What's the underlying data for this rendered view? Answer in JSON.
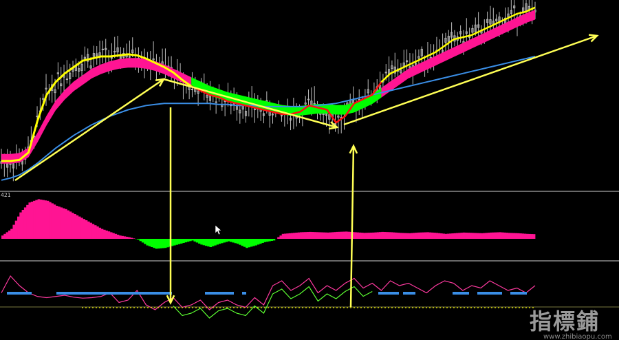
{
  "chart_data": {
    "type": "line",
    "title": "",
    "panes": [
      {
        "name": "price",
        "grid": false
      },
      {
        "name": "histogram",
        "grid": false,
        "label": "421"
      },
      {
        "name": "oscillator",
        "grid": false
      }
    ],
    "colors": {
      "background": "#000000",
      "separator": "#8a8a8a",
      "candles": "#bdbdbd",
      "fast_ma_up": "#ffff00",
      "fast_ma_down": "#ff1010",
      "band_bull": "#ff1493",
      "band_bear": "#00ff00",
      "slow_ma": "#3a8ee6",
      "annotation": "#ffff55",
      "hist_pos": "#ff1493",
      "hist_neg": "#00ff00",
      "osc_pos": "#ff3aa0",
      "osc_neg": "#5cff32",
      "osc_dash": "#3a8ee6",
      "osc_dots": "#ffff00",
      "cursor": "#ffffff"
    },
    "bars": 180,
    "series": [
      {
        "values": [
          22,
          22,
          23,
          30,
          60,
          84,
          96,
          104,
          110,
          116,
          118,
          120,
          120,
          121,
          122,
          121,
          118,
          114,
          110,
          105,
          98,
          92,
          88,
          84,
          82,
          78,
          76,
          74,
          72,
          70,
          68,
          66,
          66,
          68,
          74,
          72,
          70,
          58,
          64,
          76,
          80,
          84,
          96,
          104,
          108,
          112,
          116,
          120,
          124,
          130,
          136,
          138,
          140,
          144,
          148,
          152,
          156,
          160,
          162,
          166
        ]
      },
      {
        "values": [
          24,
          24,
          25,
          30,
          44,
          60,
          74,
          84,
          92,
          98,
          104,
          108,
          111,
          113,
          114,
          114,
          113,
          111,
          108,
          104,
          100,
          96,
          92,
          88,
          85,
          82,
          80,
          78,
          76,
          74,
          72,
          70,
          69,
          69,
          70,
          71,
          71,
          70,
          70,
          72,
          76,
          80,
          86,
          92,
          98,
          104,
          108,
          112,
          116,
          120,
          124,
          128,
          132,
          136,
          140,
          144,
          148,
          152,
          156,
          159
        ]
      },
      {
        "values": [
          4,
          6,
          9,
          14,
          20,
          27,
          34,
          40,
          46,
          51,
          56,
          60,
          64,
          67,
          70,
          72,
          74,
          75,
          76,
          76,
          76,
          76,
          76,
          76,
          75,
          75,
          74,
          74,
          74,
          73,
          73,
          73,
          73,
          73,
          73,
          74,
          75,
          76,
          78,
          80,
          82,
          84,
          86,
          88,
          90,
          92,
          94,
          96,
          98,
          100,
          102,
          104,
          106,
          108,
          110,
          112,
          114,
          116,
          118,
          120
        ]
      },
      {
        "values": [
          20,
          60,
          160,
          220,
          240,
          230,
          200,
          180,
          150,
          120,
          90,
          60,
          40,
          20,
          10,
          -5,
          -40,
          -60,
          -55,
          -40,
          -25,
          -10,
          -35,
          -50,
          -30,
          -15,
          -30,
          -55,
          -40,
          -20,
          -10,
          30,
          35,
          40,
          42,
          40,
          38,
          42,
          44,
          40,
          36,
          38,
          42,
          40,
          36,
          34,
          38,
          40,
          36,
          30,
          34,
          38,
          36,
          34,
          38,
          40,
          36,
          34,
          30,
          28
        ]
      },
      {
        "values": [
          10,
          80,
          40,
          10,
          -5,
          -10,
          -5,
          0,
          -8,
          -12,
          -10,
          -5,
          10,
          -30,
          -20,
          20,
          -40,
          -60,
          -30,
          -10,
          -50,
          -40,
          -20,
          -60,
          -30,
          -20,
          -40,
          -50,
          -10,
          -40,
          40,
          60,
          20,
          40,
          70,
          10,
          40,
          20,
          50,
          70,
          30,
          50,
          20,
          60,
          40,
          50,
          30,
          10,
          40,
          60,
          50,
          20,
          40,
          30,
          60,
          40,
          20,
          30,
          10,
          40
        ]
      }
    ],
    "dashed_segments": [
      [
        0,
        6
      ],
      [
        12,
        40
      ],
      [
        48,
        55
      ],
      [
        57,
        58
      ],
      [
        90,
        95
      ],
      [
        96,
        99
      ],
      [
        108,
        112
      ],
      [
        114,
        120
      ],
      [
        122,
        126
      ]
    ],
    "annotations": [
      {
        "type": "arrow",
        "from": [
          0,
          22
        ],
        "to": [
          39,
          118
        ]
      },
      {
        "type": "arrow",
        "from": [
          39,
          118
        ],
        "to": [
          82,
          188
        ]
      },
      {
        "type": "arrow",
        "from": [
          83,
          182
        ],
        "to": [
          145,
          50
        ]
      },
      {
        "type": "arrow",
        "from": [
          41,
          160
        ],
        "to": [
          41,
          440
        ]
      },
      {
        "type": "arrow",
        "from": [
          86,
          446
        ],
        "to": [
          86,
          212
        ]
      }
    ],
    "pane_labels": [
      "421"
    ],
    "watermark": {
      "text": "指標鋪",
      "url": "www.zhibiaopu.com"
    },
    "cursor": "arrow-pointer-icon"
  }
}
